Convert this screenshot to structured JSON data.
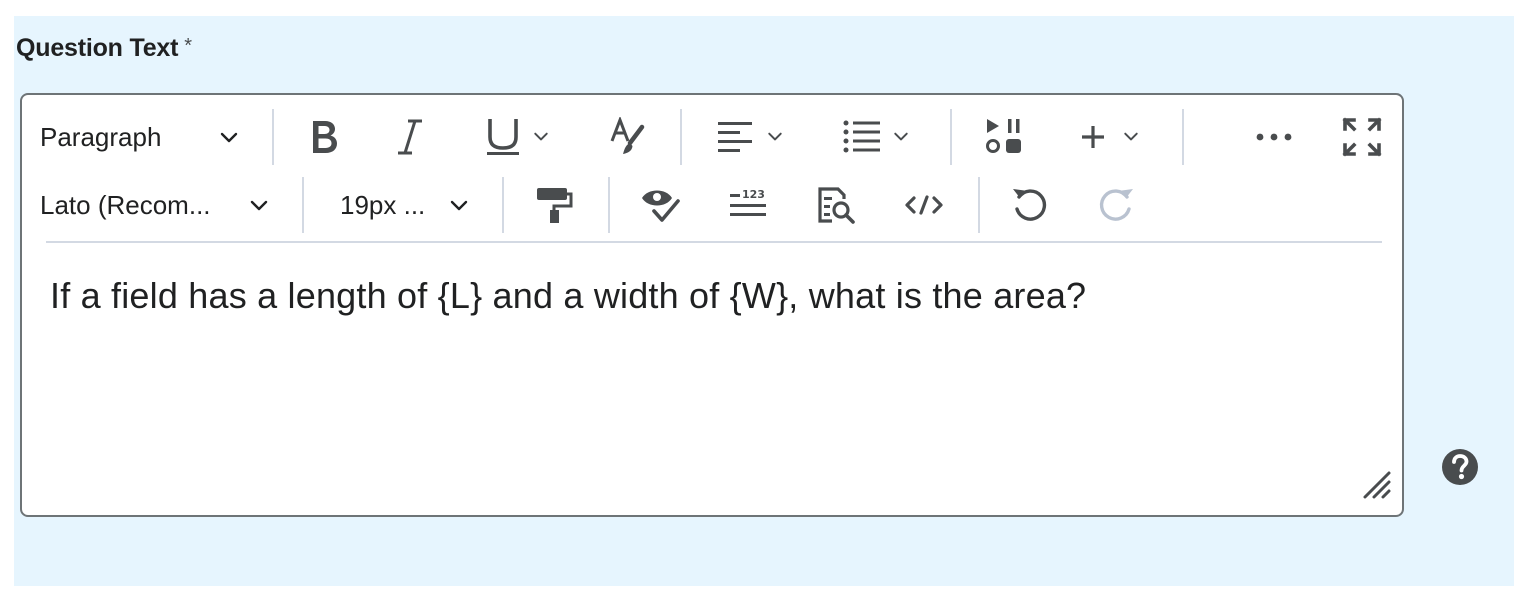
{
  "field": {
    "label": "Question Text",
    "required_marker": "*"
  },
  "toolbar": {
    "row1": {
      "block_format": "Paragraph",
      "bold_icon": "bold-icon",
      "italic_icon": "italic-icon",
      "underline_icon": "underline-icon",
      "text_color_icon": "text-color-icon",
      "align_icon": "align-left-icon",
      "list_icon": "bulleted-list-icon",
      "media_icon": "insert-media-icon",
      "insert_icon": "plus-icon",
      "more_icon": "more-icon",
      "fullscreen_icon": "fullscreen-icon"
    },
    "row2": {
      "font_family": "Lato (Recom...",
      "font_size": "19px ...",
      "format_painter_icon": "format-painter-icon",
      "accessibility_icon": "accessibility-checker-icon",
      "word_count_icon": "word-count-icon",
      "find_replace_icon": "find-replace-icon",
      "source_code_icon": "source-code-icon",
      "undo_icon": "undo-icon",
      "redo_icon": "redo-icon"
    }
  },
  "editor": {
    "content": "If a field has a length of {L} and a width of {W}, what is the area?"
  },
  "help_icon": "help-icon",
  "colors": {
    "panel_bg": "#e6f5fe",
    "icon": "#494c4e",
    "disabled_icon": "#b9c2d0",
    "separator": "#d3d9e3"
  }
}
